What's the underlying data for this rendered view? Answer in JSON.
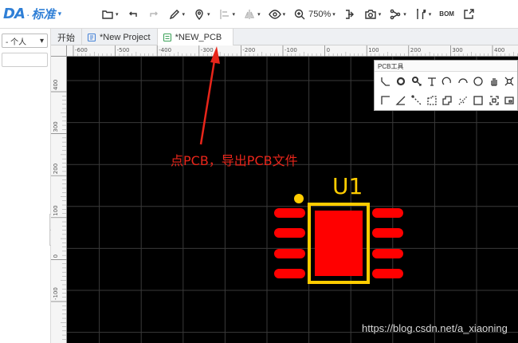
{
  "app": {
    "brand_logo": "DA",
    "brand_separator": "·",
    "brand_edition": "标准",
    "caret": "▾"
  },
  "toolbar": {
    "zoom_level": "750%",
    "bom_label": "BOM",
    "icons": [
      "file-icon",
      "undo-icon",
      "redo-icon",
      "pen-icon",
      "location-icon",
      "align-icon",
      "flip-icon",
      "eye-icon",
      "zoom-icon",
      "import-icon",
      "camera-icon",
      "share-icon",
      "tools-icon",
      "bom-icon",
      "export-icon"
    ]
  },
  "left_panel": {
    "team_select_value": "- 个人"
  },
  "tabs": [
    {
      "label": "开始",
      "active": false
    },
    {
      "label": "*New Project",
      "active": false
    },
    {
      "label": "*NEW_PCB",
      "active": true
    }
  ],
  "rulers": {
    "horizontal_labels": [
      "-600",
      "-500",
      "-400",
      "-300",
      "-200",
      "-100",
      "0",
      "100",
      "200",
      "300",
      "400"
    ],
    "vertical_labels": [
      "400",
      "300",
      "200",
      "100",
      "0",
      "-100"
    ]
  },
  "pcb_tools": {
    "title": "PCB工具"
  },
  "component": {
    "designator": "U1"
  },
  "annotation": {
    "text": "点PCB，导出PCB文件",
    "color": "#e8251a"
  },
  "colors": {
    "board_bg": "#000000",
    "pad": "#ff0000",
    "silkscreen": "#ffcc00",
    "brand": "#2f7fd6"
  },
  "watermark": "https://blog.csdn.net/a_xiaoning"
}
